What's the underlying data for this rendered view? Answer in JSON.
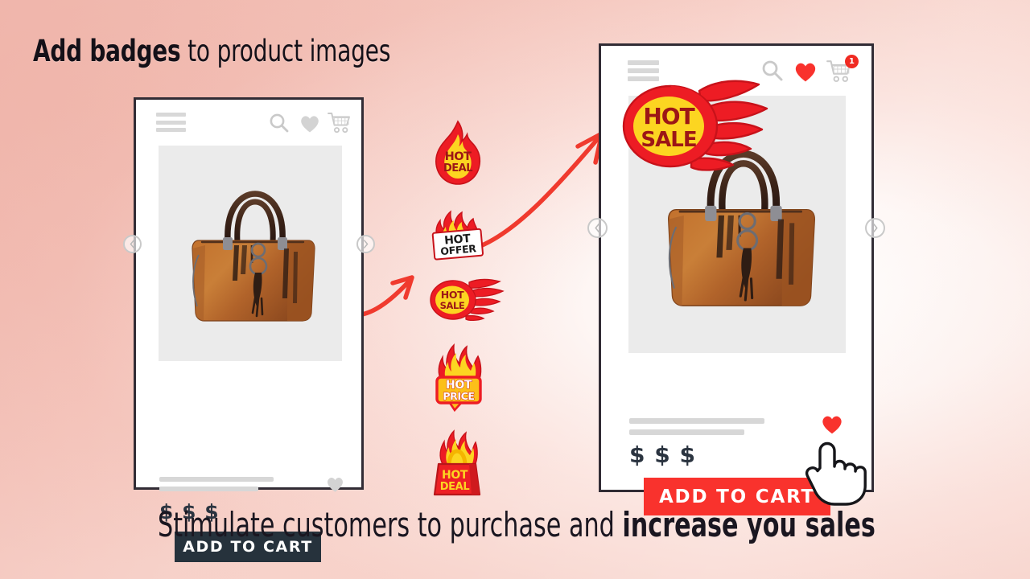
{
  "page": {
    "headline_strong": "Add badges",
    "headline_light": " to product images",
    "footer_light": "Stimulate customers to purchase and ",
    "footer_strong": "increase you sales",
    "bg_pink": "#f2bdb3",
    "accent_red": "#f9322d",
    "flame_yellow": "#fcd521",
    "dark_button": "#26323c"
  },
  "phone_before": {
    "name": "before-phone",
    "menu_icon": "hamburger-menu-icon",
    "search_icon": "search-icon",
    "wishlist_icon": "heart-icon",
    "cart_icon": "shopping-cart-icon",
    "prev_icon": "chevron-left-icon",
    "next_icon": "chevron-right-icon",
    "product_image_alt": "brown leather handbag",
    "title_placeholder_1": "",
    "title_placeholder_2": "",
    "price": "$ $ $",
    "add_to_cart": "ADD TO CART",
    "favorite_icon": "heart-outline-icon",
    "heart_color": "#d7d7d7",
    "button_color": "#26323c"
  },
  "phone_after": {
    "name": "after-phone",
    "menu_icon": "hamburger-menu-icon",
    "search_icon": "search-icon",
    "wishlist_icon": "heart-icon",
    "cart_icon": "shopping-cart-icon",
    "cart_count": "1",
    "prev_icon": "chevron-left-icon",
    "next_icon": "chevron-right-icon",
    "product_image_alt": "brown leather handbag",
    "badge_applied": "HOT SALE",
    "badge_line_1": "HOT",
    "badge_line_2": "SALE",
    "price": "$ $ $",
    "add_to_cart": "ADD TO CART",
    "favorite_icon": "heart-filled-icon",
    "heart_color": "#f9322d",
    "button_color": "#f9322d",
    "cursor_icon": "hand-pointer-cursor"
  },
  "badges": [
    {
      "id": "hot-deal-flame",
      "line1": "HOT",
      "line2": "DEAL",
      "style": "flame-drop",
      "text_color": "#9c1616",
      "fill": "#fcd521",
      "stroke": "#ed1c24"
    },
    {
      "id": "hot-offer-label",
      "line1": "HOT",
      "line2": "OFFER",
      "style": "white-label",
      "text_color": "#1a1a1a",
      "fill": "#ffffff",
      "stroke": "#ed1c24"
    },
    {
      "id": "hot-sale-comet",
      "line1": "HOT",
      "line2": "SALE",
      "style": "comet",
      "text_color": "#9c1616",
      "fill": "#fcd521",
      "stroke": "#ed1c24"
    },
    {
      "id": "hot-price-plate",
      "line1": "HOT",
      "line2": "PRICE",
      "style": "plate",
      "text_color": "#ffffff",
      "fill": "#fcbf19",
      "stroke": "#ed1c24"
    },
    {
      "id": "hot-deal-bag",
      "line1": "HOT",
      "line2": "DEAL",
      "style": "shopping-bag",
      "text_color": "#fcd521",
      "fill": "#ed2024",
      "stroke": "#b8161a"
    }
  ],
  "arrows": [
    {
      "id": "arrow-to-phone",
      "from": "hot-offer-badge",
      "to": "after-phone-image"
    },
    {
      "id": "arrow-from-left",
      "from": "before-phone",
      "to": "badge-column"
    }
  ]
}
